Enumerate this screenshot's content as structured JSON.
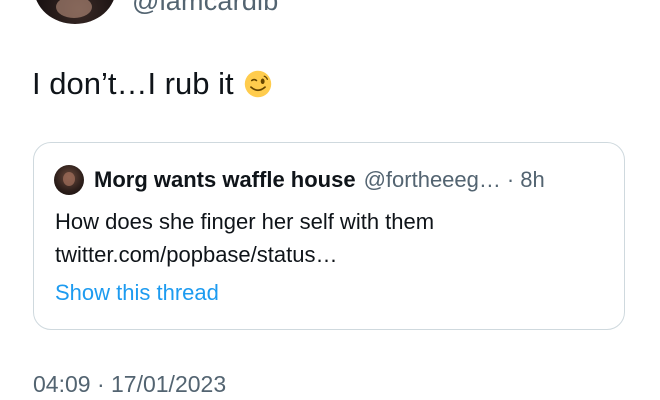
{
  "author": {
    "handle": "@iamcardib"
  },
  "tweet": {
    "text": "I don’t…I rub it",
    "emoji": "winking-face"
  },
  "quoted_tweet": {
    "name": "Morg wants waffle house",
    "handle": "@fortheeeg…",
    "separator": "·",
    "time": "8h",
    "line1": "How does she finger her self with them",
    "line2": "twitter.com/popbase/status…",
    "show_thread": "Show this thread"
  },
  "meta": {
    "timestamp": "04:09 · 17/01/2023"
  },
  "colors": {
    "text": "#0f1419",
    "secondary": "#536471",
    "link": "#1d9bf0",
    "border": "#cfd9de"
  }
}
